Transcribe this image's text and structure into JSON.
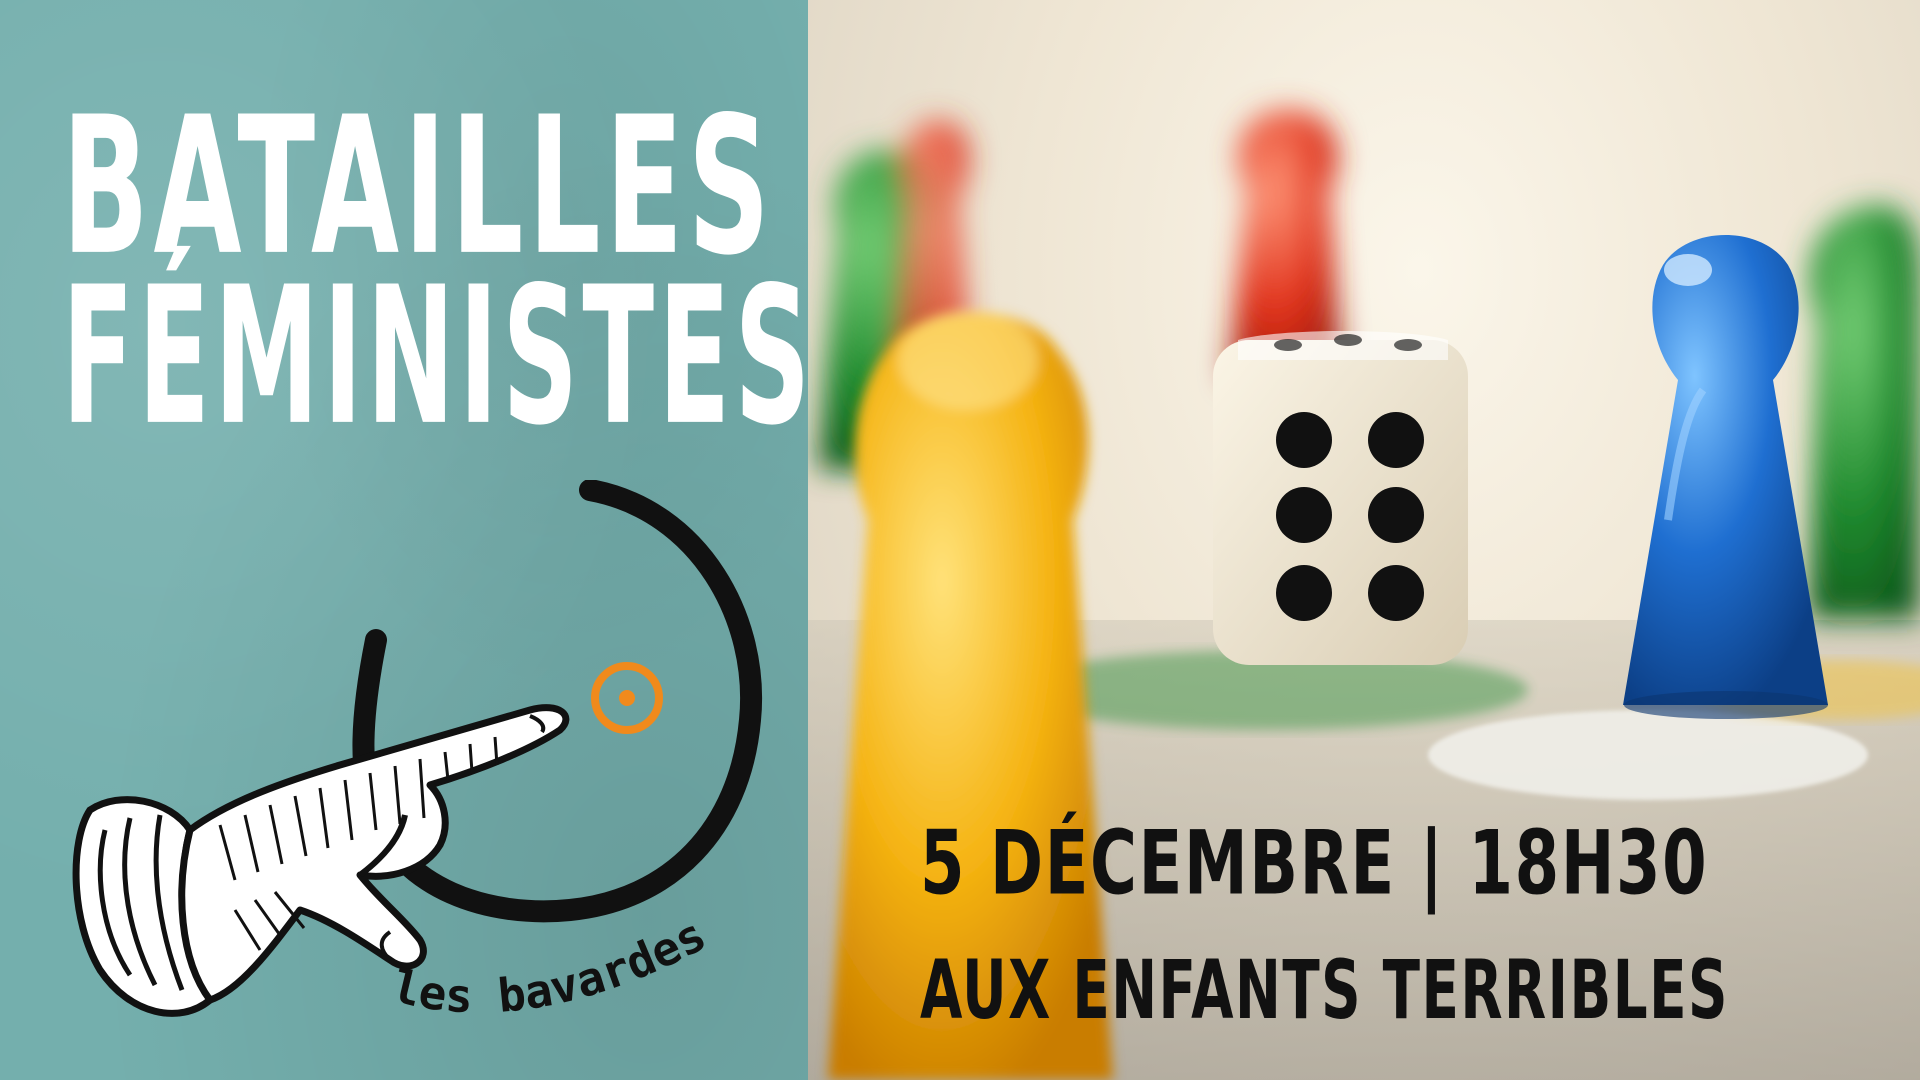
{
  "poster": {
    "title_line_1": "BATAILLES",
    "title_line_2": "FÉMINISTES",
    "logo": {
      "text": "les bavardes",
      "icon": "pointing-hand-icon"
    },
    "event": {
      "date_time": "5 DÉCEMBRE | 18H30",
      "location": "AUX ENFANTS TERRIBLES"
    },
    "colors": {
      "panel_teal": "#74afad",
      "title_white": "#ffffff",
      "logo_black": "#111111",
      "logo_orange": "#f08a1c",
      "event_text": "#111111"
    },
    "photo": {
      "subject": "board game pawns and die",
      "die_face_shown": 6,
      "pawn_colors": [
        "yellow",
        "blue",
        "green",
        "red"
      ]
    }
  }
}
